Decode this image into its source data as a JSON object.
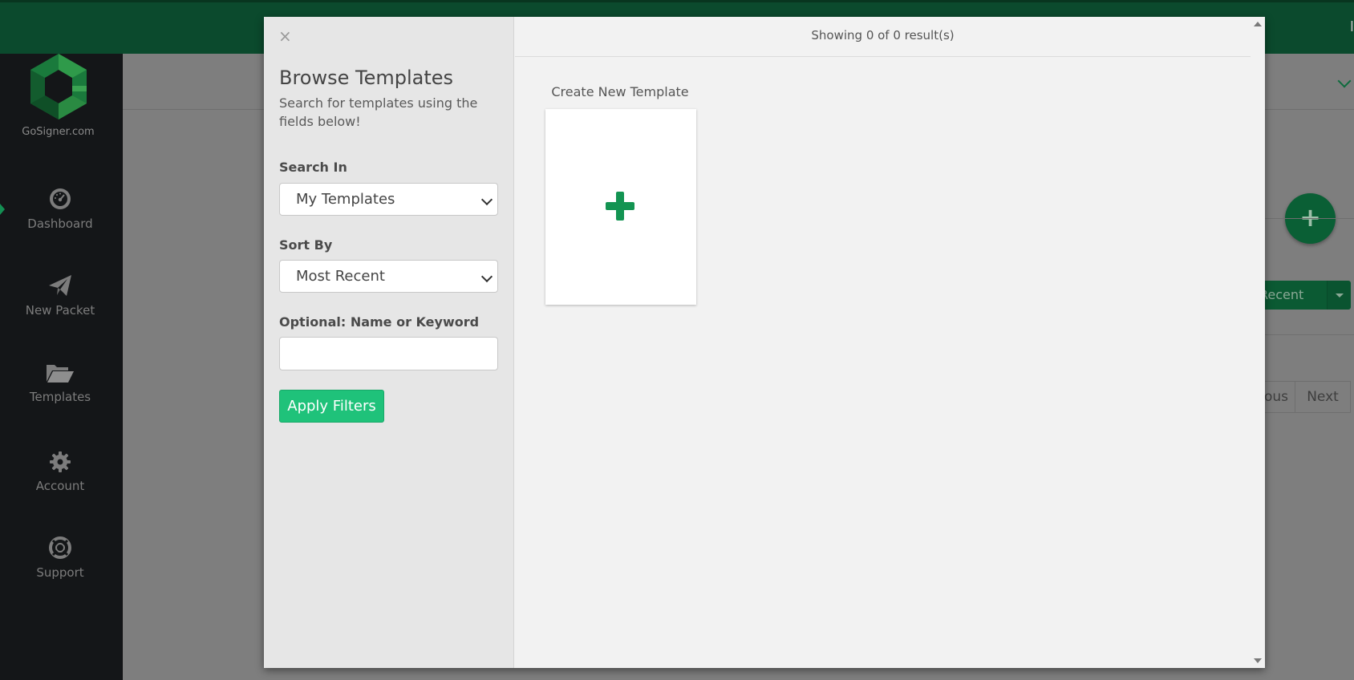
{
  "app": {
    "brand": "GoSigner.com",
    "topbar_edge_text": "I"
  },
  "sidebar": {
    "items": [
      {
        "label": "Dashboard",
        "icon": "dashboard-icon"
      },
      {
        "label": "New Packet",
        "icon": "paper-plane-icon"
      },
      {
        "label": "Templates",
        "icon": "folder-open-icon"
      },
      {
        "label": "Account",
        "icon": "gear-icon"
      },
      {
        "label": "Support",
        "icon": "lifebuoy-icon"
      }
    ]
  },
  "background": {
    "fab_label": "+",
    "sort_button_label": "Recent",
    "pager": {
      "previous": "ous",
      "next": "Next"
    }
  },
  "modal": {
    "close_label": "×",
    "title": "Browse Templates",
    "subtitle": "Search for templates using the fields below!",
    "search_in": {
      "label": "Search In",
      "value": "My Templates"
    },
    "sort_by": {
      "label": "Sort By",
      "value": "Most Recent"
    },
    "keyword": {
      "label": "Optional: Name or Keyword",
      "value": "",
      "placeholder": ""
    },
    "apply_label": "Apply Filters",
    "results_text": "Showing 0 of 0 result(s)",
    "create_card_label": "Create New Template"
  },
  "colors": {
    "brand_green": "#1fc27a",
    "plus_green": "#139452",
    "topbar": "#0b4a2d"
  }
}
